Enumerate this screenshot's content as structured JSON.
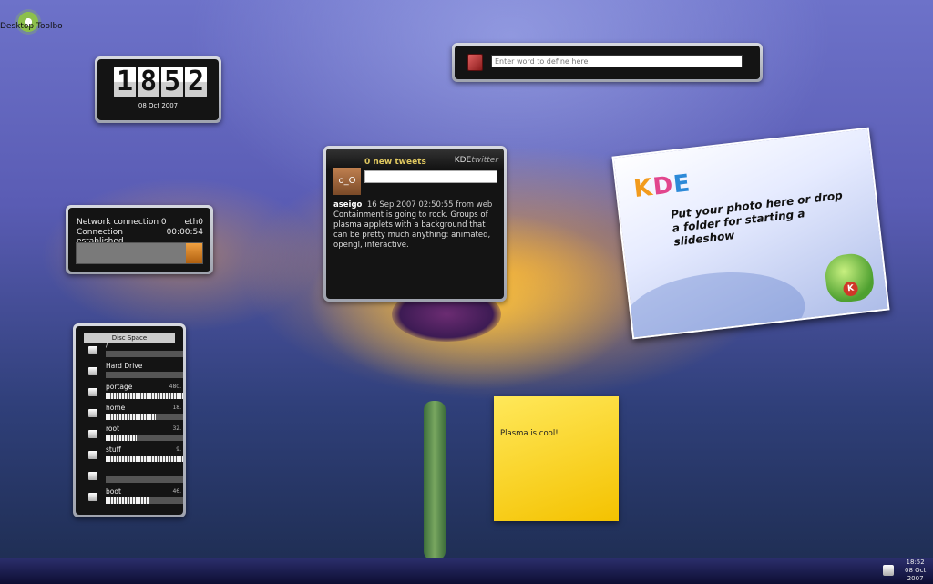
{
  "desktop": {
    "toolbox_label": "Desktop Toolbo"
  },
  "clock": {
    "digits": [
      "1",
      "8",
      "5",
      "2"
    ],
    "date": "08 Oct 2007"
  },
  "dictionary": {
    "placeholder": "Enter word to define here"
  },
  "network": {
    "line1_left": "Network connection 0",
    "line1_right": "eth0",
    "line2_left": "Connection established",
    "line2_right": "00:00:54"
  },
  "twitter": {
    "new_tweets": "0 new tweets",
    "brand_kde": "KDE",
    "brand_twitter": "twitter",
    "avatar_text": "o_O",
    "user": "aseigo",
    "meta": "16 Sep 2007 02:50:55 from web",
    "text": "Containment is going to rock. Groups of plasma applets with a background that can be pretty much anything: animated, opengl, interactive."
  },
  "photo_frame": {
    "logo": [
      "K",
      "D",
      "E"
    ],
    "message": "Put your photo here or drop a folder for starting a slideshow",
    "badge": "K"
  },
  "disc_space": {
    "title": "Disc Space",
    "items": [
      {
        "name": "/",
        "size": "",
        "used": 0
      },
      {
        "name": "Hard Drive",
        "size": "",
        "used": 0
      },
      {
        "name": "portage",
        "size": "480.",
        "used": 1.0
      },
      {
        "name": "home",
        "size": "18.",
        "used": 0.65
      },
      {
        "name": "root",
        "size": "32.",
        "used": 0.4
      },
      {
        "name": "stuff",
        "size": "9.",
        "used": 1.0
      },
      {
        "name": "",
        "size": "",
        "used": 0
      },
      {
        "name": "boot",
        "size": "46.",
        "used": 0.55
      }
    ]
  },
  "note": {
    "text": "Plasma is cool!"
  },
  "panel": {
    "time": "18:52",
    "date_line1": "08 Oct",
    "date_line2": "2007"
  }
}
